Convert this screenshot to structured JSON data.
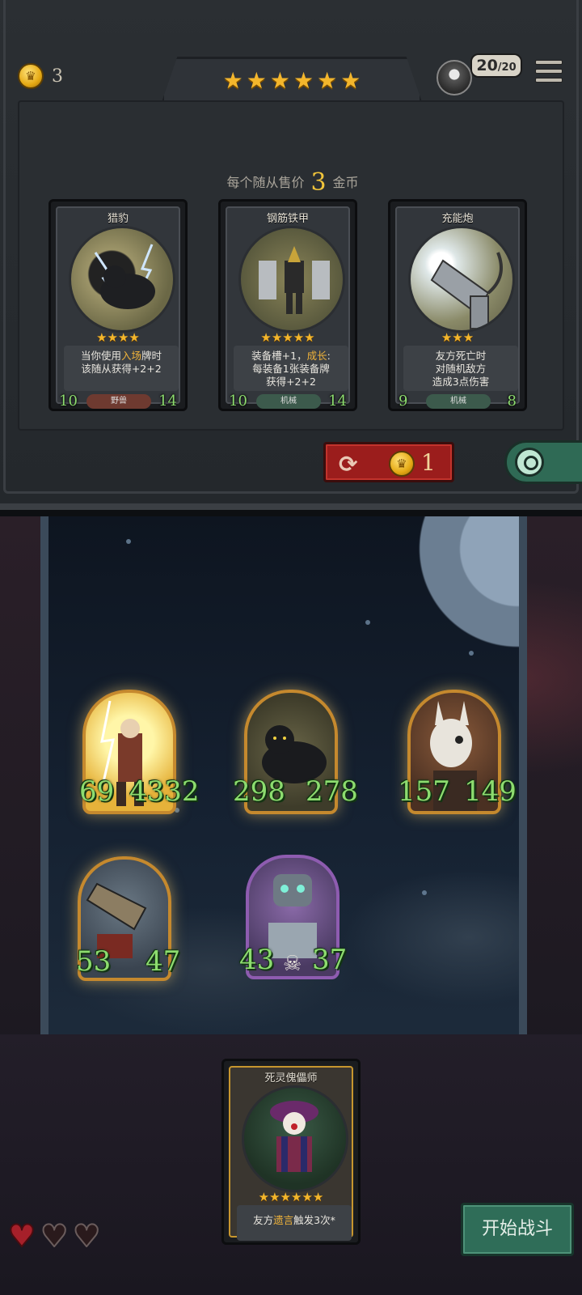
{
  "header": {
    "gold": "3",
    "tier_stars": 6,
    "player_hp_current": "20",
    "player_hp_max": "/20"
  },
  "shop": {
    "sell_prefix": "每个随从售价",
    "sell_price": "3",
    "sell_suffix": "金币",
    "cards": [
      {
        "name": "猎豹",
        "stars": 4,
        "desc_pre": "当你使用",
        "desc_hl": "入场",
        "desc_post": "牌时\n该随从获得+2+2",
        "atk": "10",
        "hp": "14",
        "tribe": "野兽"
      },
      {
        "name": "钢筋铁甲",
        "stars": 5,
        "desc_pre": "装备槽+1，",
        "desc_hl": "成长",
        "desc_post": ":\n每装备1张装备牌\n获得+2+2",
        "atk": "10",
        "hp": "14",
        "tribe": "机械"
      },
      {
        "name": "充能炮",
        "stars": 3,
        "desc_pre": "",
        "desc_hl": "",
        "desc_post": "友方死亡时\n对随机敌方\n造成3点伤害",
        "atk": "9",
        "hp": "8",
        "tribe": "机械"
      }
    ],
    "reroll_cost": "1"
  },
  "board": {
    "units": [
      {
        "atk": "69",
        "hp": "4332"
      },
      {
        "atk": "298",
        "hp": "278"
      },
      {
        "atk": "157",
        "hp": "149"
      },
      {
        "atk": "53",
        "hp": "47"
      },
      {
        "atk": "43",
        "hp": "37"
      }
    ]
  },
  "hand": {
    "name": "死灵傀儡师",
    "stars": 6,
    "desc_pre": "友方",
    "desc_hl": "遗言",
    "desc_post": "触发3次*"
  },
  "lives": {
    "full": 1,
    "total": 3
  },
  "start_button": "开始战斗",
  "colors": {
    "gold": "#f3b62c",
    "stat_green": "#8ddc6f",
    "reroll_red": "#9b1d1c",
    "start_green": "#2f6d58"
  }
}
